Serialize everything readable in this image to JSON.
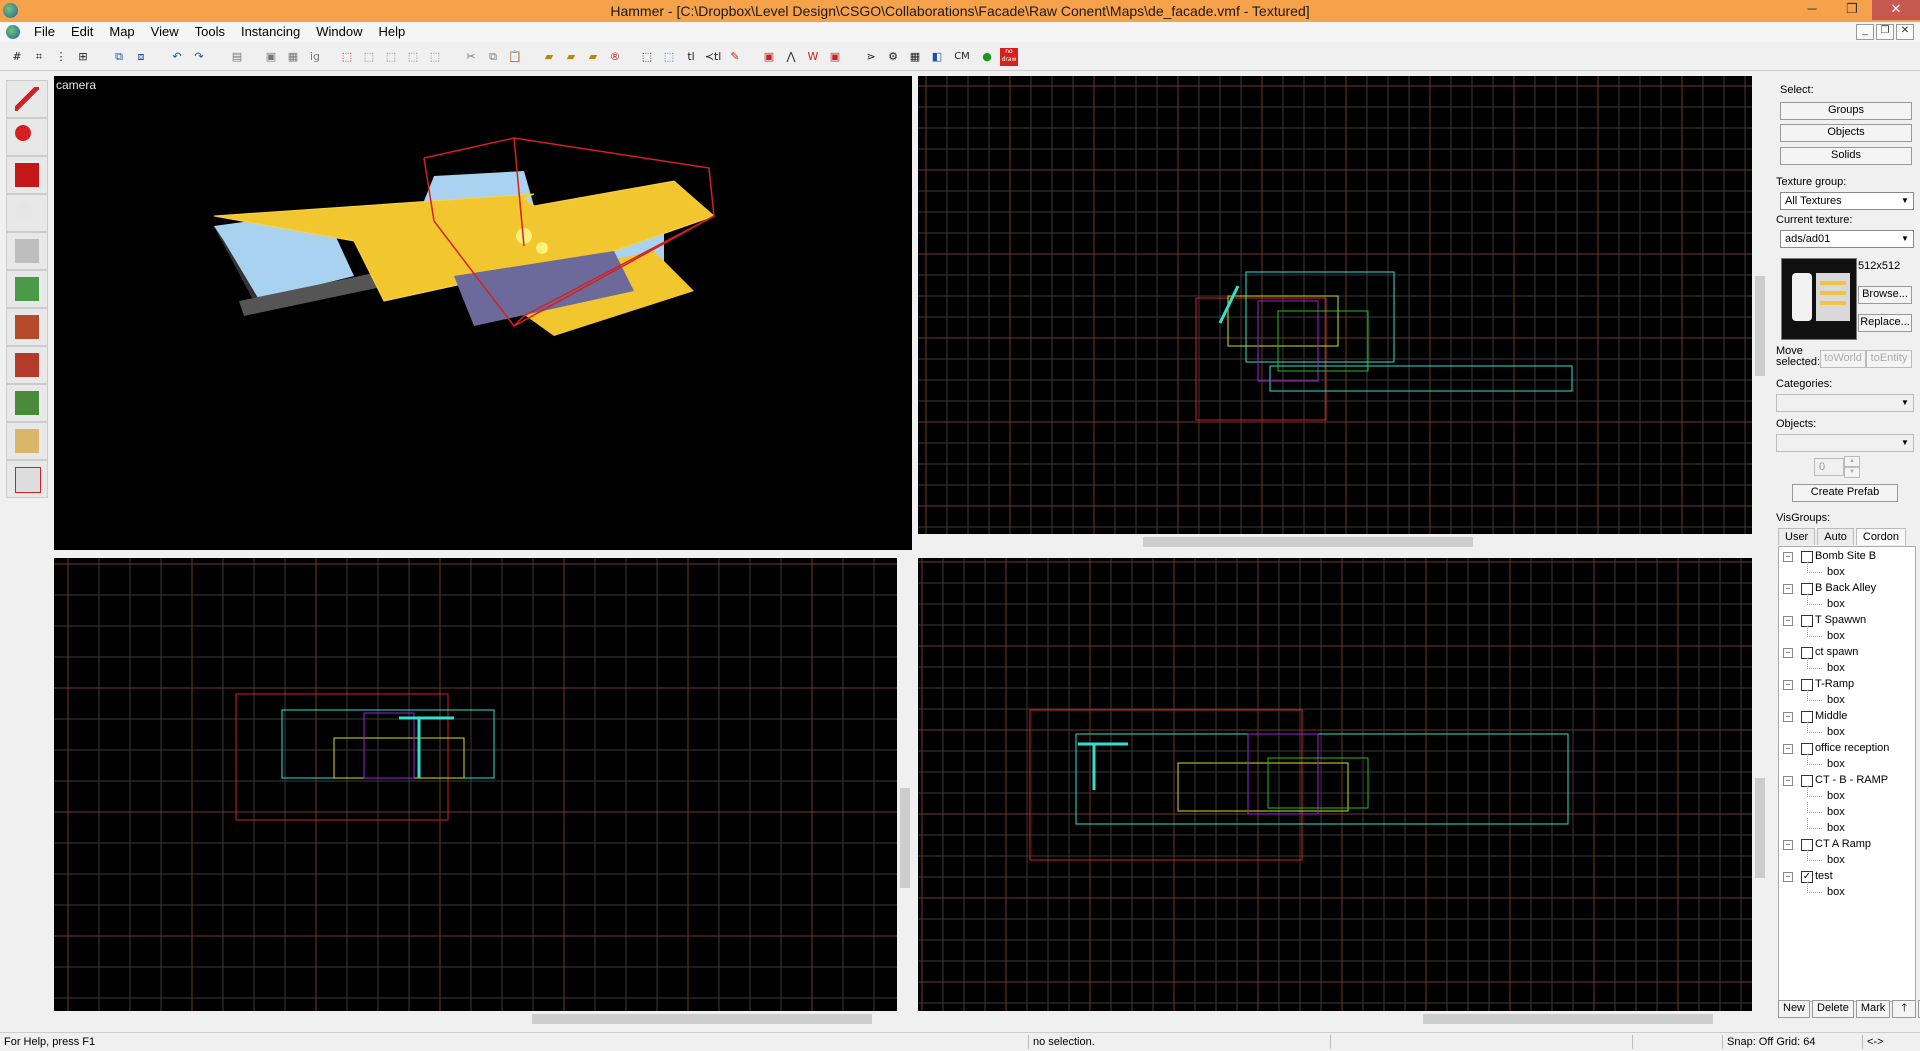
{
  "window": {
    "title": "Hammer - [C:\\Dropbox\\Level Design\\CSGO\\Collaborations\\Facade\\Raw Conent\\Maps\\de_facade.vmf - Textured]",
    "minimize": "─",
    "restore": "❐",
    "close": "✕"
  },
  "menu": [
    "File",
    "Edit",
    "Map",
    "View",
    "Tools",
    "Instancing",
    "Window",
    "Help"
  ],
  "mdi": {
    "min": "_",
    "restore": "❐",
    "close": "✕"
  },
  "toolbar": {
    "cm_label": "CM",
    "nodraw_label": "no draw"
  },
  "viewports": {
    "camera_label": "camera"
  },
  "panel": {
    "select_label": "Select:",
    "groups": "Groups",
    "objects": "Objects",
    "solids": "Solids",
    "texture_group_label": "Texture group:",
    "texture_group_value": "All Textures",
    "current_texture_label": "Current texture:",
    "current_texture_value": "ads/ad01",
    "texture_size": "512x512",
    "browse": "Browse...",
    "replace": "Replace...",
    "move_selected_label": "Move selected:",
    "to_world": "toWorld",
    "to_entity": "toEntity",
    "categories_label": "Categories:",
    "objects_label": "Objects:",
    "spinner_value": "0",
    "create_prefab": "Create Prefab",
    "visgroups_label": "VisGroups:",
    "tabs": [
      "User",
      "Auto",
      "Cordon"
    ],
    "visgroups": [
      {
        "name": "Bomb Site B",
        "checked": false,
        "children": [
          "box"
        ]
      },
      {
        "name": "B Back Alley",
        "checked": false,
        "children": [
          "box"
        ]
      },
      {
        "name": "T Spawwn",
        "checked": false,
        "children": [
          "box"
        ]
      },
      {
        "name": "ct spawn",
        "checked": false,
        "children": [
          "box"
        ]
      },
      {
        "name": "T-Ramp",
        "checked": false,
        "children": [
          "box"
        ]
      },
      {
        "name": "Middle",
        "checked": false,
        "children": [
          "box"
        ]
      },
      {
        "name": "office reception",
        "checked": false,
        "children": [
          "box"
        ]
      },
      {
        "name": "CT - B - RAMP",
        "checked": false,
        "children": [
          "box",
          "box",
          "box"
        ]
      },
      {
        "name": "CT A Ramp",
        "checked": false,
        "children": [
          "box"
        ]
      },
      {
        "name": "test",
        "checked": true,
        "children": [
          "box"
        ]
      }
    ],
    "new": "New",
    "delete": "Delete",
    "mark": "Mark",
    "up": "🡑",
    "down": "🡓"
  },
  "status": {
    "help": "For Help, press F1",
    "selection": "no selection.",
    "snap": "Snap: Off Grid: 64",
    "arrows": "<->"
  },
  "colors": {
    "title_accent": "#f5a24a",
    "viewport_bg": "#000000",
    "grid_minor": "#3a3a3a",
    "grid_major": "#6a3a2a",
    "cordon": "#cc2222"
  }
}
